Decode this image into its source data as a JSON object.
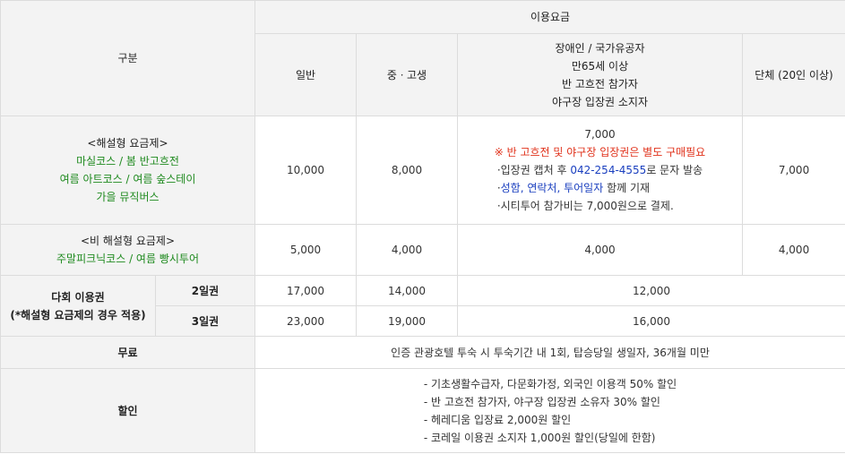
{
  "header": {
    "category": "구분",
    "usage_fee": "이용요금",
    "general": "일반",
    "middle_high": "중ㆍ고생",
    "special_lines": [
      "장애인 / 국가유공자",
      "만65세 이상",
      "반 고흐전 참가자",
      "야구장 입장권 소지자"
    ],
    "group": "단체 (20인 이상)"
  },
  "rows": {
    "explained": {
      "title": "<해설형 요금제>",
      "courses": [
        "마실코스 / 봄 반고흐전",
        "여름 아트코스 / 여름 숲스테이",
        "가을 뮤직버스"
      ],
      "general": "10,000",
      "middle_high": "8,000",
      "special_price": "7,000",
      "special_note": "※ 반 고흐전 및 야구장 입장권은 별도 구매필요",
      "bullet1_prefix": "·입장권 캡처 후 ",
      "bullet1_phone": "042-254-4555",
      "bullet1_suffix": "로 문자 발송",
      "bullet2_prefix": "·",
      "bullet2_highlight": "성함, 연락처, 투어일자",
      "bullet2_suffix": " 함께 기재",
      "bullet3": "·시티투어 참가비는 7,000원으로 결제.",
      "group": "7,000"
    },
    "non_explained": {
      "title": "<비 해설형 요금제>",
      "courses": "주말피크닉코스 / 여름 빵시투어",
      "general": "5,000",
      "middle_high": "4,000",
      "special": "4,000",
      "group": "4,000"
    },
    "multi_pass": {
      "title": "다회 이용권",
      "subtitle": "(*해설형 요금제의 경우 적용)",
      "two_day": {
        "label": "2일권",
        "general": "17,000",
        "middle_high": "14,000",
        "other": "12,000"
      },
      "three_day": {
        "label": "3일권",
        "general": "23,000",
        "middle_high": "19,000",
        "other": "16,000"
      }
    },
    "free": {
      "label": "무료",
      "text": "인증 관광호텔 투숙 시 투숙기간 내 1회, 탑승당일 생일자, 36개월 미만"
    },
    "discount": {
      "label": "할인",
      "items": [
        "- 기초생활수급자, 다문화가정, 외국인 이용객 50% 할인",
        "- 반 고흐전 참가자, 야구장 입장권 소유자 30% 할인",
        "- 헤레디움 입장료 2,000원 할인",
        "- 코레일 이용권 소지자 1,000원 할인(당일에 한함)"
      ]
    }
  },
  "colors": {
    "header_bg": "#f3f3f3",
    "border": "#dcdcdc",
    "green": "#1f8a1f",
    "red": "#e0311a",
    "blue": "#1a3fbf"
  }
}
